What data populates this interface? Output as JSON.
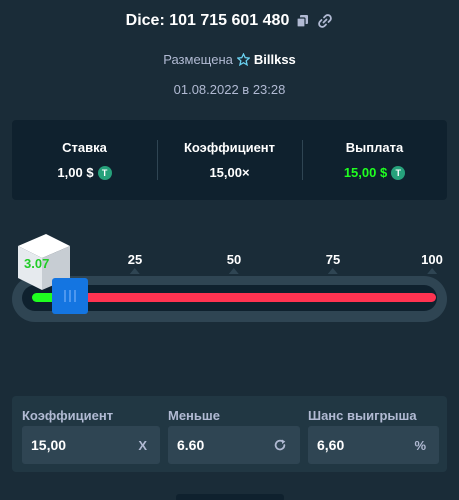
{
  "header": {
    "title": "Dice: 101 715 601 480",
    "icons": [
      "copy-icon",
      "link-icon"
    ]
  },
  "placed": {
    "label": "Размещена",
    "user": "Billkss",
    "user_icon": "star-icon"
  },
  "date": "01.08.2022 в 23:28",
  "stats": {
    "bet_label": "Ставка",
    "bet_value": "1,00 $",
    "multiplier_label": "Коэффициент",
    "multiplier_value": "15,00×",
    "payout_label": "Выплата",
    "payout_value": "15,00 $",
    "currency_icon": "tether-icon",
    "currency_glyph": "T"
  },
  "slider": {
    "ticks": [
      "25",
      "50",
      "75",
      "100"
    ],
    "roll_result": "3.07",
    "roll_under": 6.6,
    "range": [
      0,
      100
    ],
    "colors": {
      "win": "#1fff20",
      "lose": "#ff3351",
      "handle": "#1475e1"
    }
  },
  "controls": {
    "multiplier_label": "Коэффициент",
    "multiplier_value": "15,00",
    "multiplier_suffix": "X",
    "roll_label": "Меньше",
    "roll_value": "6.60",
    "roll_icon": "refresh-icon",
    "chance_label": "Шанс выигрыша",
    "chance_value": "6,60",
    "chance_suffix": "%"
  },
  "colors": {
    "background": "#1a2c38",
    "panel": "#0f212e",
    "accent_green": "#1fff20",
    "muted_text": "#b1bad3"
  }
}
